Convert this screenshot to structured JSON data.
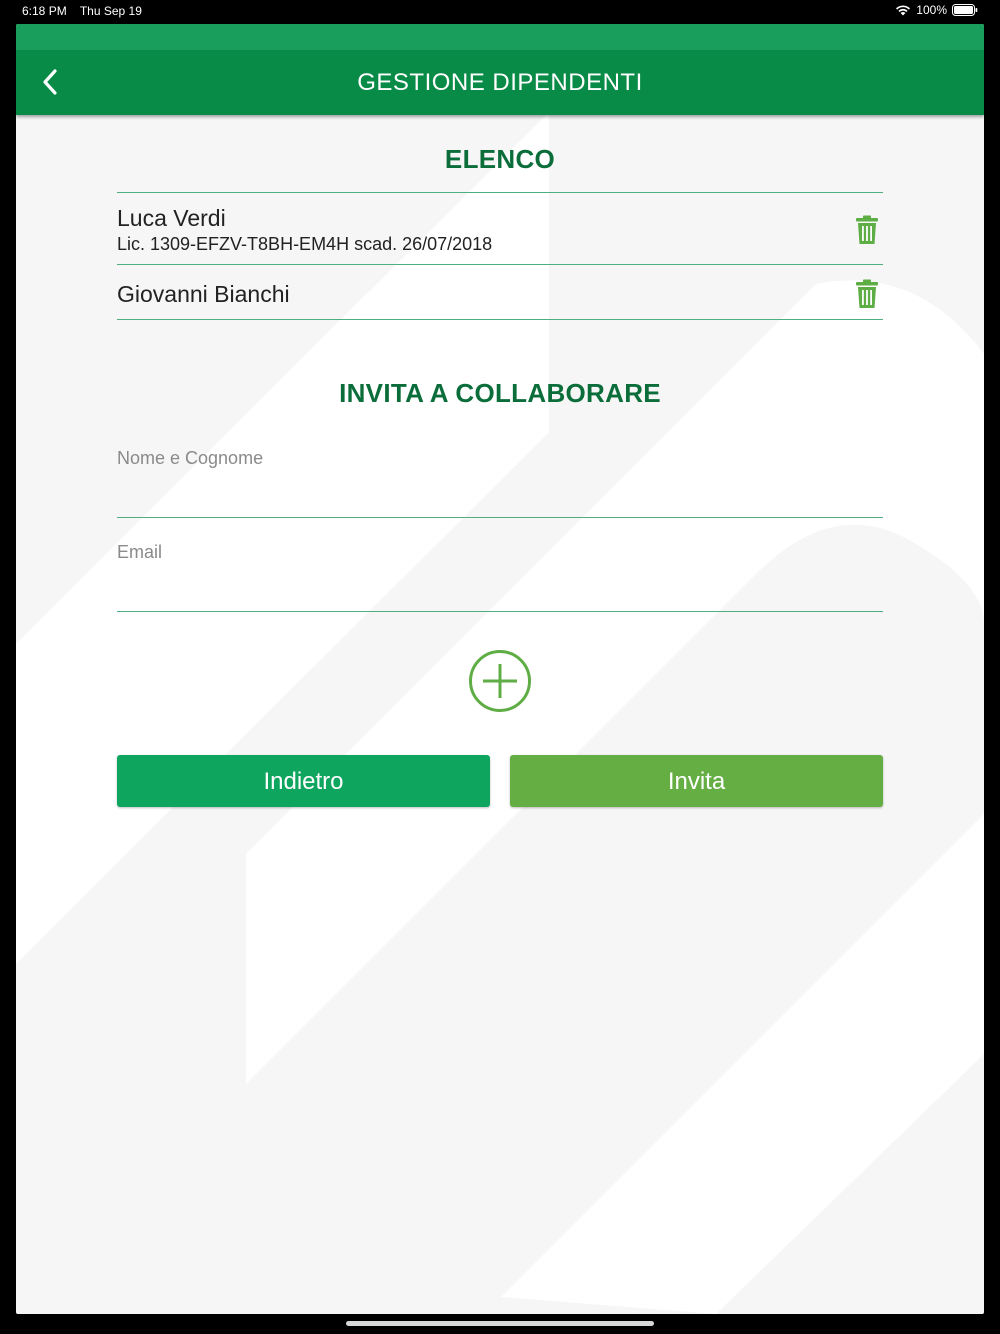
{
  "status_bar": {
    "time": "6:18 PM",
    "date": "Thu Sep 19",
    "battery": "100%"
  },
  "header": {
    "title": "GESTIONE DIPENDENTI",
    "back_icon": "chevron-left-icon"
  },
  "list_section": {
    "title": "ELENCO",
    "items": [
      {
        "name": "Luca Verdi",
        "license": "Lic. 1309-EFZV-T8BH-EM4H scad. 26/07/2018"
      },
      {
        "name": "Giovanni Bianchi"
      }
    ],
    "delete_icon": "trash-icon"
  },
  "invite_section": {
    "title": "INVITA A COLLABORARE",
    "name_field": {
      "label": "Nome e Cognome",
      "value": ""
    },
    "email_field": {
      "label": "Email",
      "value": ""
    },
    "add_icon": "plus-circle-icon"
  },
  "buttons": {
    "back_label": "Indietro",
    "invite_label": "Invita"
  },
  "colors": {
    "header": "#078b46",
    "header_top": "#1a9e5c",
    "title_green": "#0b6e3a",
    "icon_green": "#5fad45",
    "back_button": "#0ea55f",
    "invite_button": "#65ae44"
  }
}
